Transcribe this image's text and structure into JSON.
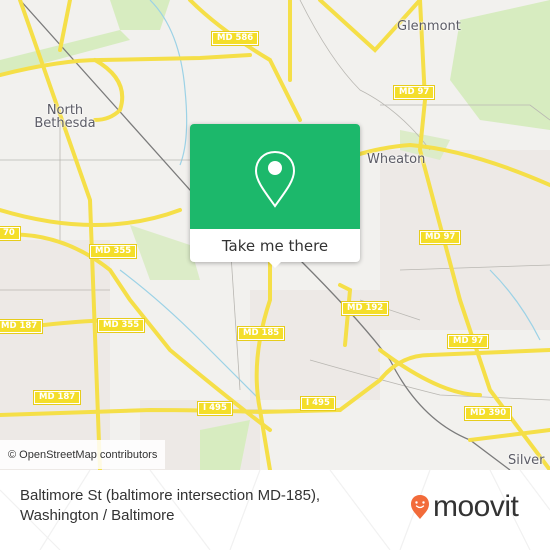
{
  "map": {
    "places": [
      {
        "name": "Glenmont"
      },
      {
        "name": "North Bethesda"
      },
      {
        "name": "Wheaton"
      },
      {
        "name": "Silver"
      }
    ],
    "road_shields": [
      "MD 586",
      "MD 97",
      "MD 97",
      "MD 97",
      "MD 355",
      "MD 355",
      "MD 187",
      "MD 187",
      "MD 192",
      "MD 185",
      "I 495",
      "I 495",
      "MD 390",
      "70"
    ],
    "attribution": "© OpenStreetMap contributors"
  },
  "popup": {
    "icon": "location-pin-icon",
    "button_label": "Take me there",
    "color": "#1cb86b"
  },
  "footer": {
    "address_line1": "Baltimore St (baltimore intersection MD-185),",
    "address_line2": "Washington / Baltimore",
    "brand": "moovit",
    "brand_color": "#f26b3a"
  }
}
